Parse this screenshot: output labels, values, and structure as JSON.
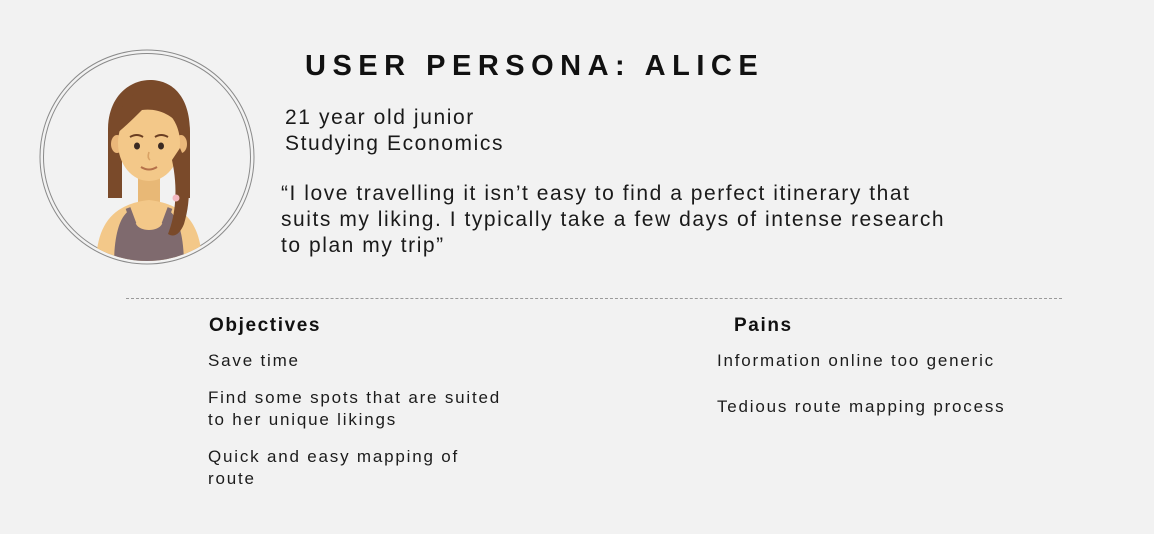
{
  "persona": {
    "title": "USER PERSONA: ALICE",
    "age_line": "21 year old junior",
    "study_line": "Studying Economics",
    "quote_lines": [
      "“I love travelling it isn’t easy to find a perfect itinerary that",
      "suits my liking. I typically take a few days of intense research",
      "to plan my trip”"
    ],
    "avatar_icon": "female-avatar-icon"
  },
  "objectives": {
    "heading": "Objectives",
    "items": [
      [
        "Save time"
      ],
      [
        "Find some spots that are suited",
        "to her unique likings"
      ],
      [
        "Quick and easy mapping of",
        "route"
      ]
    ]
  },
  "pains": {
    "heading": "Pains",
    "items": [
      [
        "Information online too generic"
      ],
      [
        "Tedious route mapping process"
      ]
    ]
  },
  "colors": {
    "background": "#f2f2f2",
    "text": "#1c1c1c",
    "skin": "#f3c889",
    "hair": "#7a4a2a",
    "top": "#7f6a6e"
  }
}
